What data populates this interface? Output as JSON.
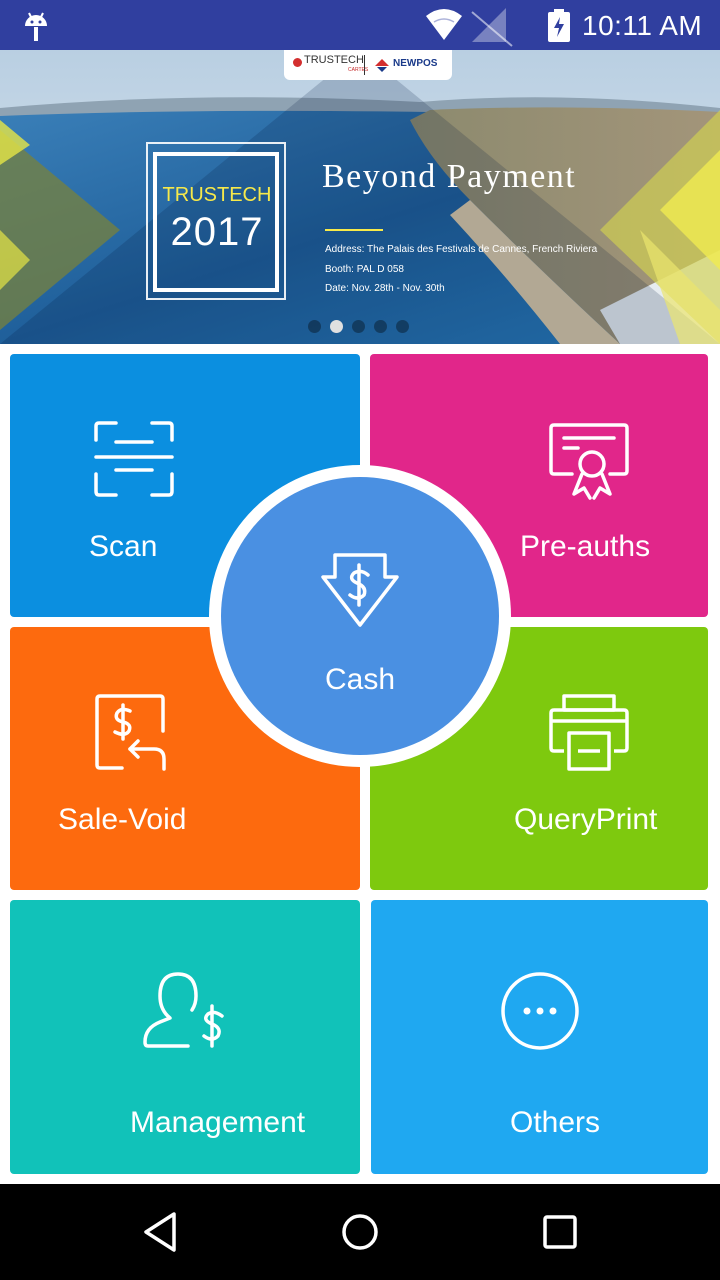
{
  "status_bar": {
    "time": "10:11 AM",
    "icons": [
      "android-debug-icon",
      "wifi-icon",
      "no-signal-icon",
      "battery-charging-icon"
    ]
  },
  "banner": {
    "logo_trustech": "TRUSTECH",
    "logo_cartes": "CARTES",
    "logo_newpos": "NEWPOS",
    "event_word": "TRUSTECH",
    "event_year": "2017",
    "headline": "Beyond Payment",
    "address": "Address: The Palais des Festivals de Cannes, French Riviera",
    "booth": "Booth: PAL D 058",
    "date": "Date: Nov. 28th - Nov. 30th",
    "carousel_pages": 5,
    "carousel_active": 2
  },
  "tiles": {
    "scan": {
      "label": "Scan",
      "icon": "scan-icon",
      "color": "#0b8fe0"
    },
    "pre_auths": {
      "label": "Pre-auths",
      "icon": "certificate-icon",
      "color": "#e1268a"
    },
    "cash": {
      "label": "Cash",
      "icon": "cash-download-icon",
      "color": "#4a90e2"
    },
    "sale_void": {
      "label": "Sale-Void",
      "icon": "refund-icon",
      "color": "#fd6a0e"
    },
    "query_print": {
      "label": "QueryPrint",
      "icon": "printer-icon",
      "color": "#7ec90e"
    },
    "management": {
      "label": "Management",
      "icon": "user-dollar-icon",
      "color": "#11c2b9"
    },
    "others": {
      "label": "Others",
      "icon": "more-icon",
      "color": "#1fa8f1"
    }
  },
  "nav_bar": {
    "buttons": [
      "back-icon",
      "home-icon",
      "recents-icon"
    ]
  }
}
